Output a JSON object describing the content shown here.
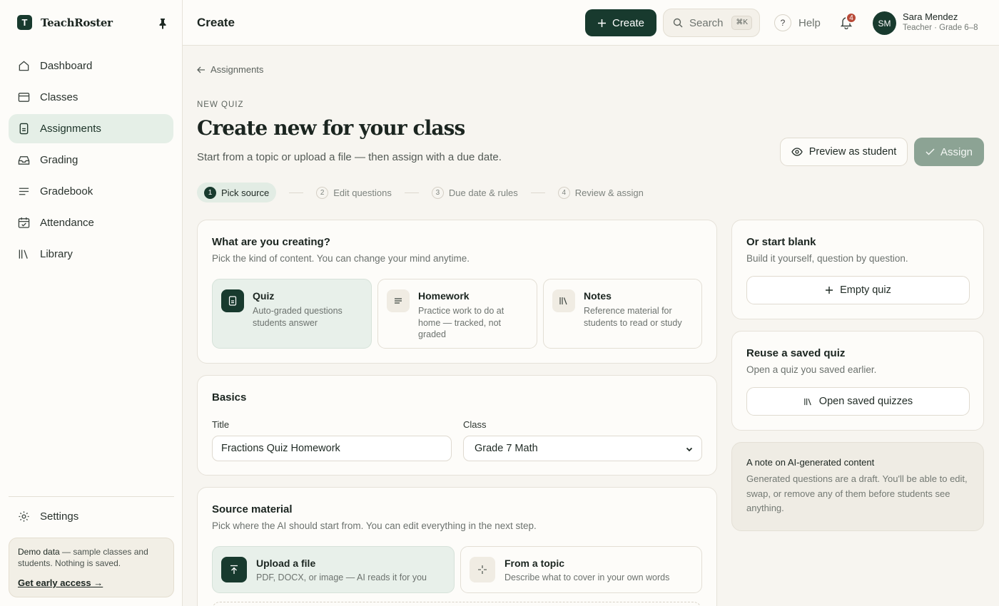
{
  "brand": {
    "initial": "T",
    "name": "TeachRoster"
  },
  "sidebar": {
    "items": [
      {
        "label": "Dashboard",
        "icon": "home-icon"
      },
      {
        "label": "Classes",
        "icon": "classes-icon"
      },
      {
        "label": "Assignments",
        "icon": "assignment-icon",
        "active": true
      },
      {
        "label": "Grading",
        "icon": "inbox-icon"
      },
      {
        "label": "Gradebook",
        "icon": "list-icon"
      },
      {
        "label": "Attendance",
        "icon": "calendar-check-icon"
      },
      {
        "label": "Library",
        "icon": "library-icon"
      }
    ],
    "settings_label": "Settings",
    "demo": {
      "bold": "Demo data",
      "text": " — sample classes and students. Nothing is saved.",
      "link": "Get early access →"
    }
  },
  "topbar": {
    "title": "Create",
    "create_label": "Create",
    "search_label": "Search",
    "search_shortcut": "⌘K",
    "help_label": "Help",
    "notification_count": "4",
    "user": {
      "initials": "SM",
      "name": "Sara Mendez",
      "role": "Teacher · Grade 6–8"
    }
  },
  "page": {
    "back_label": "Assignments",
    "eyebrow": "NEW QUIZ",
    "title": "Create new for your class",
    "subtitle": "Start from a topic or upload a file — then assign with a due date.",
    "preview_label": "Preview as student",
    "assign_label": "Assign"
  },
  "steps": [
    {
      "num": "1",
      "label": "Pick source"
    },
    {
      "num": "2",
      "label": "Edit questions"
    },
    {
      "num": "3",
      "label": "Due date & rules"
    },
    {
      "num": "4",
      "label": "Review & assign"
    }
  ],
  "creating": {
    "title": "What are you creating?",
    "subtitle": "Pick the kind of content. You can change your mind anytime.",
    "types": [
      {
        "name": "Quiz",
        "desc": "Auto-graded questions students answer"
      },
      {
        "name": "Homework",
        "desc": "Practice work to do at home — tracked, not graded"
      },
      {
        "name": "Notes",
        "desc": "Reference material for students to read or study"
      }
    ]
  },
  "basics": {
    "title": "Basics",
    "title_label": "Title",
    "title_value": "Fractions Quiz Homework",
    "class_label": "Class",
    "class_value": "Grade 7 Math"
  },
  "source": {
    "title": "Source material",
    "subtitle": "Pick where the AI should start from. You can edit everything in the next step.",
    "options": [
      {
        "name": "Upload a file",
        "desc": "PDF, DOCX, or image — AI reads it for you"
      },
      {
        "name": "From a topic",
        "desc": "Describe what to cover in your own words"
      }
    ]
  },
  "blank": {
    "title": "Or start blank",
    "subtitle": "Build it yourself, question by question.",
    "button": "Empty quiz"
  },
  "reuse": {
    "title": "Reuse a saved quiz",
    "subtitle": "Open a quiz you saved earlier.",
    "button": "Open saved quizzes"
  },
  "note": {
    "title": "A note on AI-generated content",
    "body": "Generated questions are a draft. You'll be able to edit, swap, or remove any of them before students see anything."
  },
  "colors": {
    "brand": "#183a2e",
    "active_bg": "#e5efe7",
    "badge": "#b84a38",
    "assign_disabled": "#8ca394"
  }
}
